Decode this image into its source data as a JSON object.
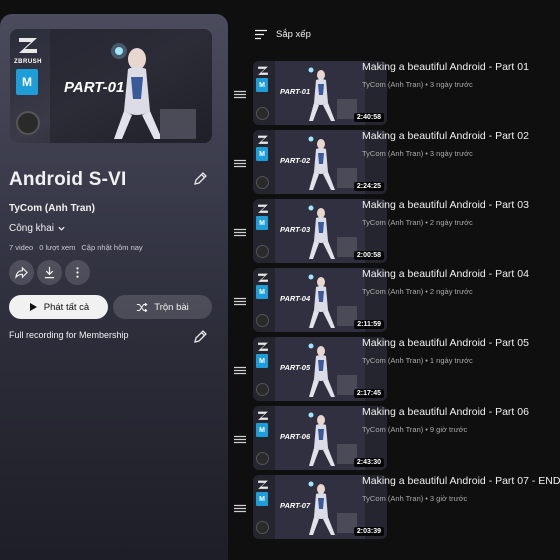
{
  "playlist": {
    "thumbnail_text": "PART-01",
    "thumbnail_brand": "ZBRUSH",
    "title": "Android S-VI",
    "owner": "TyCom (Anh Tran)",
    "privacy": "Công khai",
    "video_count": "7 video",
    "views": "0 lượt xem",
    "updated": "Cập nhật hôm nay",
    "play_all_label": "Phát tất cả",
    "shuffle_label": "Trộn bài",
    "description": "Full recording for Membership",
    "colors": {
      "accent": "#1e6fd9",
      "panel_top": "#4a4b5c",
      "panel_bottom": "#1c1d25"
    }
  },
  "sort": {
    "label": "Sắp xếp",
    "icon": "sort-icon"
  },
  "videos": [
    {
      "title": "Making a beautiful Android - Part 01",
      "channel": "TyCom (Anh Tran)",
      "age": "3 ngày trước",
      "duration": "2:40:58",
      "part": "PART-01"
    },
    {
      "title": "Making a beautiful Android - Part 02",
      "channel": "TyCom (Anh Tran)",
      "age": "3 ngày trước",
      "duration": "2:24:25",
      "part": "PART-02"
    },
    {
      "title": "Making a beautiful Android - Part 03",
      "channel": "TyCom (Anh Tran)",
      "age": "2 ngày trước",
      "duration": "2:00:58",
      "part": "PART-03"
    },
    {
      "title": "Making a beautiful Android - Part 04",
      "channel": "TyCom (Anh Tran)",
      "age": "2 ngày trước",
      "duration": "2:11:59",
      "part": "PART-04"
    },
    {
      "title": "Making a beautiful Android - Part 05",
      "channel": "TyCom (Anh Tran)",
      "age": "1 ngày trước",
      "duration": "2:17:45",
      "part": "PART-05"
    },
    {
      "title": "Making a beautiful Android - Part 06",
      "channel": "TyCom (Anh Tran)",
      "age": "9 giờ trước",
      "duration": "2:43:30",
      "part": "PART-06"
    },
    {
      "title": "Making a beautiful Android - Part 07 - END",
      "channel": "TyCom (Anh Tran)",
      "age": "3 giờ trước",
      "duration": "2:03:39",
      "part": "PART-07"
    }
  ]
}
